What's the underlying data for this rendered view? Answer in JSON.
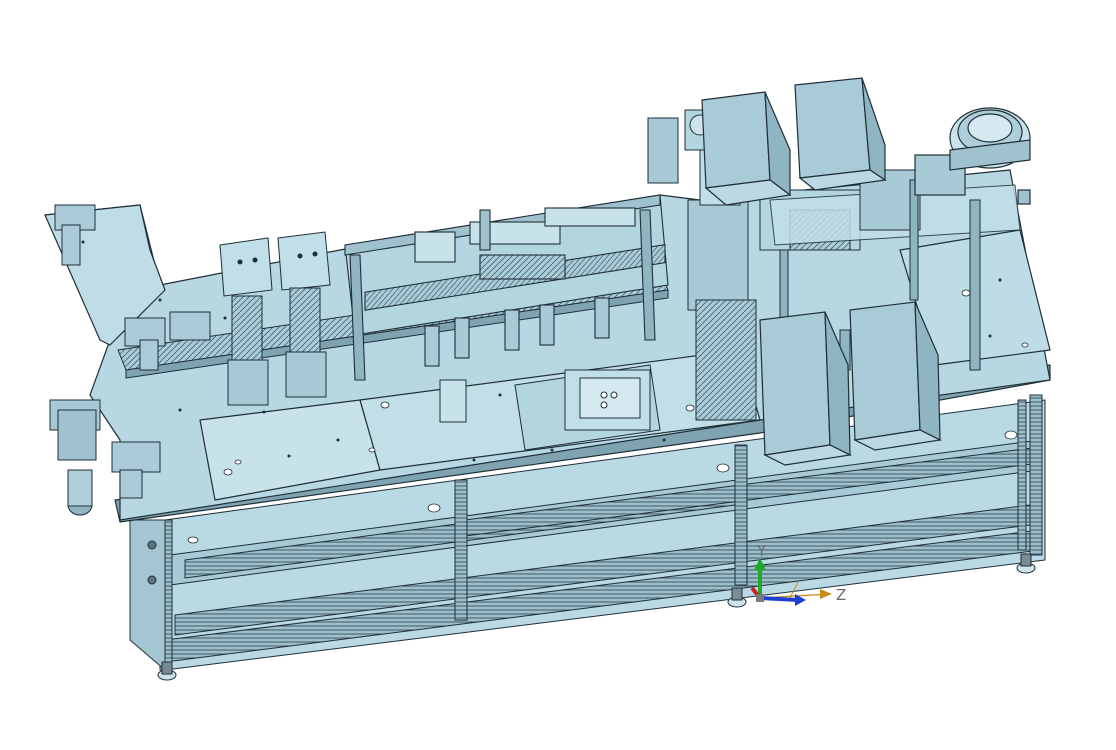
{
  "viewport": {
    "corner_text": "·······",
    "background": "#ffffff"
  },
  "model": {
    "face_color": "#b7d8e3",
    "face_light": "#cfe6ee",
    "face_dark": "#8fb4c2",
    "edge_color": "#1f2f38",
    "steel_color": "#7b8b93"
  },
  "triad": {
    "y_label": "Y",
    "z_label": "Z",
    "y_color": "#1faa2a",
    "x_color": "#d11f1f",
    "z_color": "#1f3fd1",
    "axis_z_ext_color": "#c98a1a"
  }
}
